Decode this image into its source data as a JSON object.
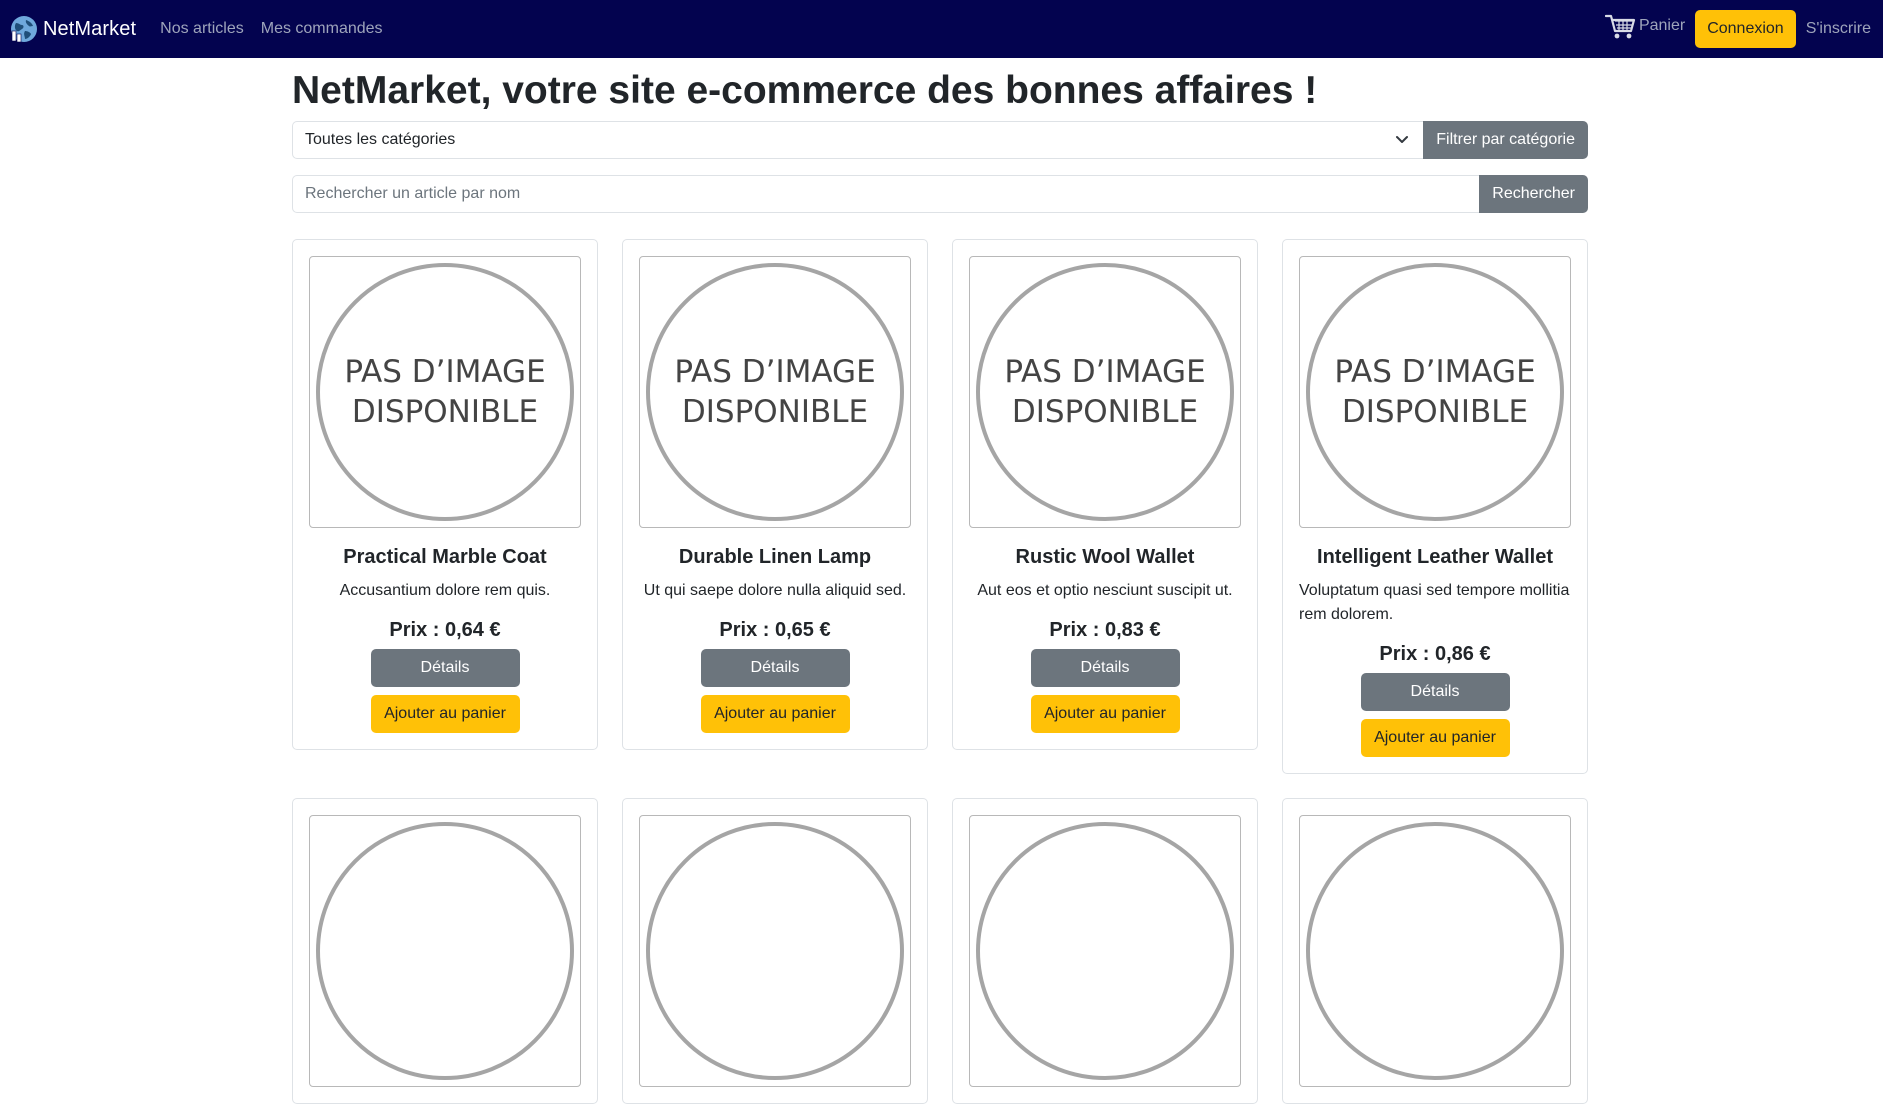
{
  "navbar": {
    "brand": "NetMarket",
    "links": [
      "Nos articles",
      "Mes commandes"
    ],
    "cart_label": "Panier",
    "login_label": "Connexion",
    "signup_label": "S'inscrire"
  },
  "main": {
    "title": "NetMarket, votre site e-commerce des bonnes affaires !",
    "category_select": {
      "selected": "Toutes les catégories"
    },
    "filter_button": "Filtrer par catégorie",
    "search": {
      "placeholder": "Rechercher un article par nom",
      "value": ""
    },
    "search_button": "Rechercher"
  },
  "placeholder_image": {
    "line1": "PAS D’IMAGE",
    "line2": "DISPONIBLE"
  },
  "products": [
    {
      "name": "Practical Marble Coat",
      "description": "Accusantium dolore rem quis.",
      "price": "Prix : 0,64 €",
      "details_label": "Détails",
      "add_label": "Ajouter au panier"
    },
    {
      "name": "Durable Linen Lamp",
      "description": "Ut qui saepe dolore nulla aliquid sed.",
      "price": "Prix : 0,65 €",
      "details_label": "Détails",
      "add_label": "Ajouter au panier"
    },
    {
      "name": "Rustic Wool Wallet",
      "description": "Aut eos et optio nesciunt suscipit ut.",
      "price": "Prix : 0,83 €",
      "details_label": "Détails",
      "add_label": "Ajouter au panier"
    },
    {
      "name": "Intelligent Leather Wallet",
      "description": "Voluptatum quasi sed tempore mollitia rem dolorem.",
      "price": "Prix : 0,86 €",
      "details_label": "Détails",
      "add_label": "Ajouter au panier"
    }
  ],
  "colors": {
    "navbar_bg": "#03034f",
    "accent": "#ffc107",
    "secondary": "#6c757d"
  }
}
